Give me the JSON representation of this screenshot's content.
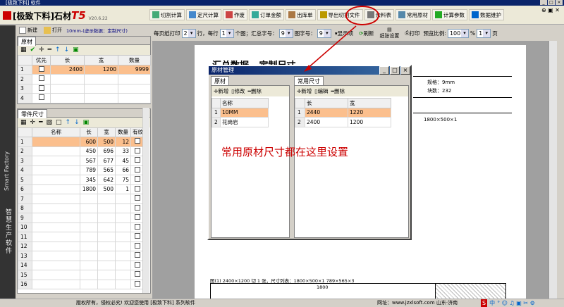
{
  "window": {
    "title": "[极致下料] 软件"
  },
  "brand": {
    "name1": "[极致下料]",
    "name2": "石材",
    "name3": "T5",
    "version": "V20.6.22"
  },
  "toolbar": [
    {
      "label": "切割计算",
      "icon": "cut-icon"
    },
    {
      "label": "定尺计算",
      "icon": "ruler-icon"
    },
    {
      "label": "作废",
      "icon": "void-icon"
    },
    {
      "label": "订单金额",
      "icon": "money-icon"
    },
    {
      "label": "出库单",
      "icon": "outbound-icon"
    },
    {
      "label": "导出切割文件",
      "icon": "export-icon"
    },
    {
      "label": "余料表",
      "icon": "table-icon"
    },
    {
      "label": "常用原材",
      "icon": "material-icon"
    },
    {
      "label": "计算参数",
      "icon": "plus-icon"
    },
    {
      "label": "数据维护",
      "icon": "db-icon"
    }
  ],
  "left_bar": {
    "new_label": "新建",
    "open_label": "打开",
    "hint": "10mm-(虚示数据：定制尺寸)"
  },
  "raw_panel": {
    "title": "原材",
    "headers": [
      "",
      "优先",
      "长",
      "宽",
      "数量"
    ],
    "rows": [
      [
        "1",
        "2400",
        "1200",
        "9999"
      ],
      [
        "2",
        "",
        "",
        ""
      ],
      [
        "3",
        "",
        "",
        ""
      ],
      [
        "4",
        "",
        "",
        ""
      ]
    ]
  },
  "parts_panel": {
    "title": "零件尺寸",
    "headers": [
      "",
      "名称",
      "长",
      "宽",
      "数量",
      "有纹"
    ],
    "rows": [
      [
        "1",
        "",
        "600",
        "500",
        "12"
      ],
      [
        "2",
        "",
        "450",
        "696",
        "33"
      ],
      [
        "3",
        "",
        "567",
        "677",
        "45"
      ],
      [
        "4",
        "",
        "789",
        "565",
        "66"
      ],
      [
        "5",
        "",
        "345",
        "642",
        "75"
      ],
      [
        "6",
        "",
        "1800",
        "500",
        "1"
      ],
      [
        "7",
        "",
        "",
        "",
        ""
      ],
      [
        "8",
        "",
        "",
        "",
        ""
      ],
      [
        "9",
        "",
        "",
        "",
        ""
      ],
      [
        "10",
        "",
        "",
        "",
        ""
      ],
      [
        "11",
        "",
        "",
        "",
        ""
      ],
      [
        "12",
        "",
        "",
        "",
        ""
      ],
      [
        "13",
        "",
        "",
        "",
        ""
      ],
      [
        "14",
        "",
        "",
        "",
        ""
      ],
      [
        "15",
        "",
        "",
        "",
        ""
      ],
      [
        "16",
        "",
        "",
        "",
        ""
      ]
    ]
  },
  "print_bar": {
    "per_page_label": "每页纸打印",
    "per_page_value": "2",
    "rows_label": "行，每行",
    "per_row_value": "1",
    "unit_label": "个图；汇总字号：",
    "summary_font": "9",
    "chart_font_label": "图字号：",
    "chart_font": "9",
    "show_label": "显示项",
    "refresh_label": "刷新",
    "paper_label": "纸张设置",
    "print_label": "打印",
    "ratio_label": "预览比例:",
    "ratio_value": "100",
    "pct": "%",
    "page_value": "1",
    "page_suffix": "页"
  },
  "preview": {
    "title": "汇总数据 - 定制尺寸",
    "thickness": "规格：9mm",
    "count": "块数：232",
    "note1": "1800×500×1",
    "footer": "图(1) 2400×1200 切 1 张，尺寸列表：1800×500×1 789×565×3",
    "dim": "1800"
  },
  "dialog": {
    "title": "原材管理",
    "left_tab": "原材",
    "right_tab": "常用尺寸",
    "add": "新增",
    "edit": "修改",
    "del": "删除",
    "edit2": "编辑",
    "del2": "删除",
    "left_headers": [
      "",
      "名称"
    ],
    "left_rows": [
      [
        "1",
        "10MM"
      ],
      [
        "2",
        "花岗岩"
      ]
    ],
    "right_headers": [
      "",
      "长",
      "宽"
    ],
    "right_rows": [
      [
        "1",
        "2440",
        "1220"
      ],
      [
        "2",
        "2400",
        "1200"
      ]
    ]
  },
  "annotation": "常用原材尺寸都在这里设置",
  "side_brand": "智慧生产软件",
  "side_logo": "Smart Factory",
  "status": {
    "left": "版权所有，侵权必究! 欢迎您使用 [极致下料] 系列软件",
    "right": "网址：www.jzxlsoft.com 山东·济南"
  },
  "tray": "中"
}
